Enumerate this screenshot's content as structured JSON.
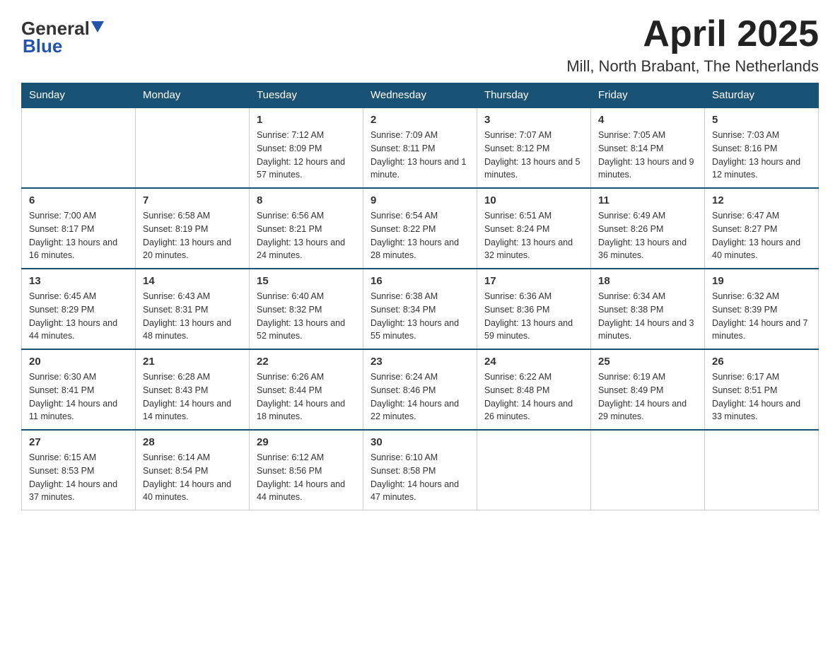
{
  "logo": {
    "text_general": "General",
    "text_blue": "Blue"
  },
  "header": {
    "month_year": "April 2025",
    "location": "Mill, North Brabant, The Netherlands"
  },
  "weekdays": [
    "Sunday",
    "Monday",
    "Tuesday",
    "Wednesday",
    "Thursday",
    "Friday",
    "Saturday"
  ],
  "weeks": [
    [
      {
        "day": "",
        "sunrise": "",
        "sunset": "",
        "daylight": ""
      },
      {
        "day": "",
        "sunrise": "",
        "sunset": "",
        "daylight": ""
      },
      {
        "day": "1",
        "sunrise": "Sunrise: 7:12 AM",
        "sunset": "Sunset: 8:09 PM",
        "daylight": "Daylight: 12 hours and 57 minutes."
      },
      {
        "day": "2",
        "sunrise": "Sunrise: 7:09 AM",
        "sunset": "Sunset: 8:11 PM",
        "daylight": "Daylight: 13 hours and 1 minute."
      },
      {
        "day": "3",
        "sunrise": "Sunrise: 7:07 AM",
        "sunset": "Sunset: 8:12 PM",
        "daylight": "Daylight: 13 hours and 5 minutes."
      },
      {
        "day": "4",
        "sunrise": "Sunrise: 7:05 AM",
        "sunset": "Sunset: 8:14 PM",
        "daylight": "Daylight: 13 hours and 9 minutes."
      },
      {
        "day": "5",
        "sunrise": "Sunrise: 7:03 AM",
        "sunset": "Sunset: 8:16 PM",
        "daylight": "Daylight: 13 hours and 12 minutes."
      }
    ],
    [
      {
        "day": "6",
        "sunrise": "Sunrise: 7:00 AM",
        "sunset": "Sunset: 8:17 PM",
        "daylight": "Daylight: 13 hours and 16 minutes."
      },
      {
        "day": "7",
        "sunrise": "Sunrise: 6:58 AM",
        "sunset": "Sunset: 8:19 PM",
        "daylight": "Daylight: 13 hours and 20 minutes."
      },
      {
        "day": "8",
        "sunrise": "Sunrise: 6:56 AM",
        "sunset": "Sunset: 8:21 PM",
        "daylight": "Daylight: 13 hours and 24 minutes."
      },
      {
        "day": "9",
        "sunrise": "Sunrise: 6:54 AM",
        "sunset": "Sunset: 8:22 PM",
        "daylight": "Daylight: 13 hours and 28 minutes."
      },
      {
        "day": "10",
        "sunrise": "Sunrise: 6:51 AM",
        "sunset": "Sunset: 8:24 PM",
        "daylight": "Daylight: 13 hours and 32 minutes."
      },
      {
        "day": "11",
        "sunrise": "Sunrise: 6:49 AM",
        "sunset": "Sunset: 8:26 PM",
        "daylight": "Daylight: 13 hours and 36 minutes."
      },
      {
        "day": "12",
        "sunrise": "Sunrise: 6:47 AM",
        "sunset": "Sunset: 8:27 PM",
        "daylight": "Daylight: 13 hours and 40 minutes."
      }
    ],
    [
      {
        "day": "13",
        "sunrise": "Sunrise: 6:45 AM",
        "sunset": "Sunset: 8:29 PM",
        "daylight": "Daylight: 13 hours and 44 minutes."
      },
      {
        "day": "14",
        "sunrise": "Sunrise: 6:43 AM",
        "sunset": "Sunset: 8:31 PM",
        "daylight": "Daylight: 13 hours and 48 minutes."
      },
      {
        "day": "15",
        "sunrise": "Sunrise: 6:40 AM",
        "sunset": "Sunset: 8:32 PM",
        "daylight": "Daylight: 13 hours and 52 minutes."
      },
      {
        "day": "16",
        "sunrise": "Sunrise: 6:38 AM",
        "sunset": "Sunset: 8:34 PM",
        "daylight": "Daylight: 13 hours and 55 minutes."
      },
      {
        "day": "17",
        "sunrise": "Sunrise: 6:36 AM",
        "sunset": "Sunset: 8:36 PM",
        "daylight": "Daylight: 13 hours and 59 minutes."
      },
      {
        "day": "18",
        "sunrise": "Sunrise: 6:34 AM",
        "sunset": "Sunset: 8:38 PM",
        "daylight": "Daylight: 14 hours and 3 minutes."
      },
      {
        "day": "19",
        "sunrise": "Sunrise: 6:32 AM",
        "sunset": "Sunset: 8:39 PM",
        "daylight": "Daylight: 14 hours and 7 minutes."
      }
    ],
    [
      {
        "day": "20",
        "sunrise": "Sunrise: 6:30 AM",
        "sunset": "Sunset: 8:41 PM",
        "daylight": "Daylight: 14 hours and 11 minutes."
      },
      {
        "day": "21",
        "sunrise": "Sunrise: 6:28 AM",
        "sunset": "Sunset: 8:43 PM",
        "daylight": "Daylight: 14 hours and 14 minutes."
      },
      {
        "day": "22",
        "sunrise": "Sunrise: 6:26 AM",
        "sunset": "Sunset: 8:44 PM",
        "daylight": "Daylight: 14 hours and 18 minutes."
      },
      {
        "day": "23",
        "sunrise": "Sunrise: 6:24 AM",
        "sunset": "Sunset: 8:46 PM",
        "daylight": "Daylight: 14 hours and 22 minutes."
      },
      {
        "day": "24",
        "sunrise": "Sunrise: 6:22 AM",
        "sunset": "Sunset: 8:48 PM",
        "daylight": "Daylight: 14 hours and 26 minutes."
      },
      {
        "day": "25",
        "sunrise": "Sunrise: 6:19 AM",
        "sunset": "Sunset: 8:49 PM",
        "daylight": "Daylight: 14 hours and 29 minutes."
      },
      {
        "day": "26",
        "sunrise": "Sunrise: 6:17 AM",
        "sunset": "Sunset: 8:51 PM",
        "daylight": "Daylight: 14 hours and 33 minutes."
      }
    ],
    [
      {
        "day": "27",
        "sunrise": "Sunrise: 6:15 AM",
        "sunset": "Sunset: 8:53 PM",
        "daylight": "Daylight: 14 hours and 37 minutes."
      },
      {
        "day": "28",
        "sunrise": "Sunrise: 6:14 AM",
        "sunset": "Sunset: 8:54 PM",
        "daylight": "Daylight: 14 hours and 40 minutes."
      },
      {
        "day": "29",
        "sunrise": "Sunrise: 6:12 AM",
        "sunset": "Sunset: 8:56 PM",
        "daylight": "Daylight: 14 hours and 44 minutes."
      },
      {
        "day": "30",
        "sunrise": "Sunrise: 6:10 AM",
        "sunset": "Sunset: 8:58 PM",
        "daylight": "Daylight: 14 hours and 47 minutes."
      },
      {
        "day": "",
        "sunrise": "",
        "sunset": "",
        "daylight": ""
      },
      {
        "day": "",
        "sunrise": "",
        "sunset": "",
        "daylight": ""
      },
      {
        "day": "",
        "sunrise": "",
        "sunset": "",
        "daylight": ""
      }
    ]
  ]
}
